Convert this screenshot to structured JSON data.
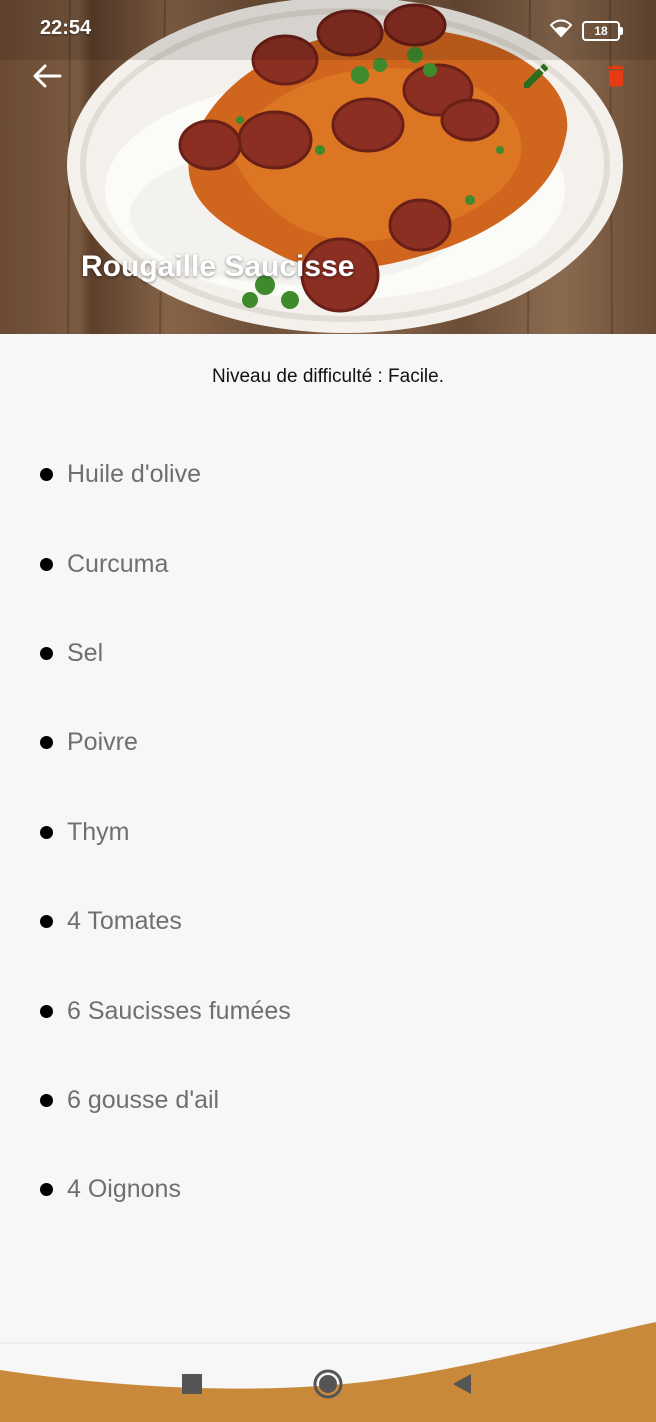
{
  "status_bar": {
    "time": "22:54",
    "battery": "18",
    "battery_level": 0.18
  },
  "header": {
    "title": "Rougaille Saucisse",
    "back_icon": "arrow-left-icon",
    "edit_icon": "pencil-icon",
    "delete_icon": "trash-icon"
  },
  "difficulty_text": "Niveau de difficulté : Facile.",
  "ingredients": [
    "Huile d'olive",
    "Curcuma",
    "Sel",
    "Poivre",
    "Thym",
    "4 Tomates",
    "6 Saucisses fumées",
    "6 gousse d'ail",
    "4 Oignons"
  ],
  "colors": {
    "edit_icon": "#2e6b1f",
    "delete_icon": "#e53a12",
    "nav_wave": "#c88a3a",
    "text_muted": "#6f6f6f",
    "background": "#f7f7f7"
  }
}
